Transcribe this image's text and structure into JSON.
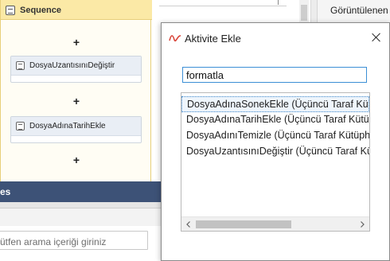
{
  "designer": {
    "sequence_title": "Sequence",
    "plus_symbol": "+",
    "activities": [
      {
        "label": "DosyaUzantısınıDeğiştir"
      },
      {
        "label": "DosyaAdınaTarihEkle"
      }
    ]
  },
  "right_panel": {
    "label": "Görüntülenen"
  },
  "bottom_panel": {
    "title": "es",
    "search_placeholder": "ütfen arama içeriği giriniz"
  },
  "dialog": {
    "title": "Aktivite Ekle",
    "search_value": "formatla",
    "results": [
      "DosyaAdınaSonekEkle (Üçüncü Taraf Kütüphanesi)",
      "DosyaAdınaTarihEkle (Üçüncü Taraf Kütüphanesi)",
      "DosyaAdınıTemizle (Üçüncü Taraf Kütüphanesi)",
      "DosyaUzantısınıDeğiştir (Üçüncü Taraf Kütüphanesi)"
    ],
    "selected_index": 0,
    "hscroll_fraction": 0.6
  },
  "colors": {
    "accent_blue": "#3c8fd6",
    "panel_header": "#3d5277",
    "sequence_header": "#fbe9a6",
    "logo_red": "#d9453a"
  }
}
